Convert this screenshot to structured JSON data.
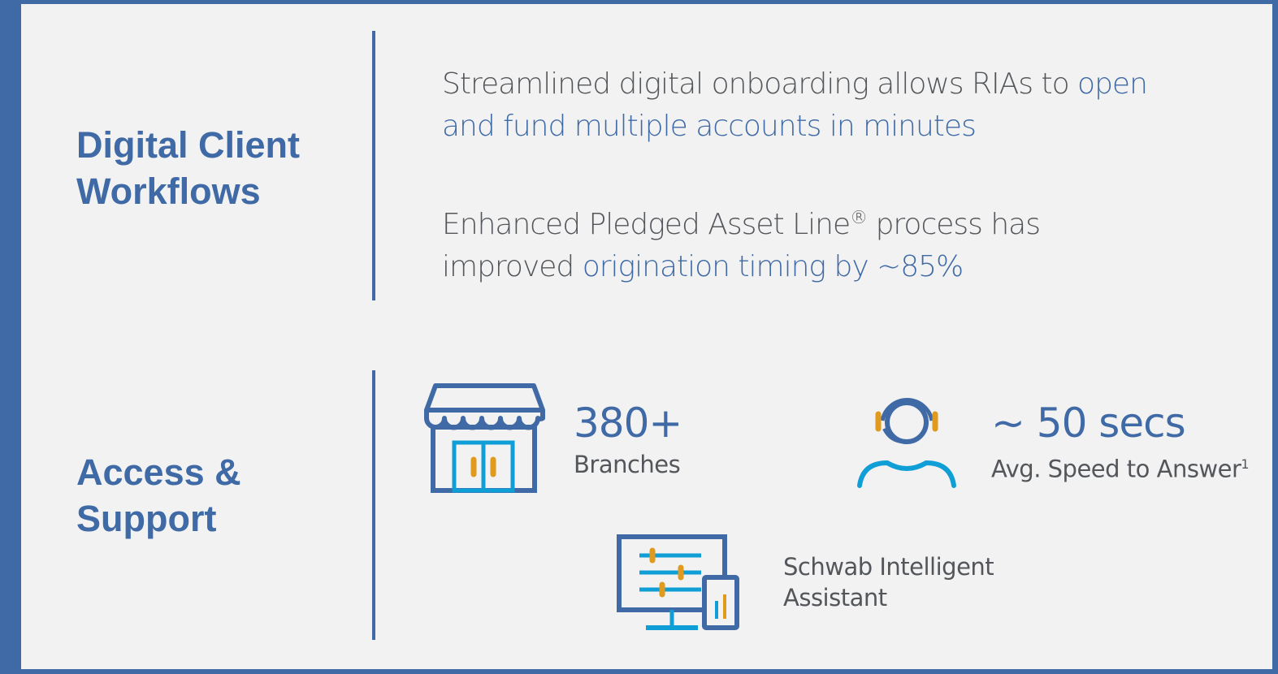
{
  "sections": [
    {
      "title_line1": "Digital Client",
      "title_line2": "Workflows"
    },
    {
      "title_line1": "Access &",
      "title_line2": "Support"
    }
  ],
  "workflows": {
    "item1": {
      "line1_plain": "Streamlined digital onboarding allows RIAs to ",
      "line1_highlight": "open",
      "line2_highlight": "and fund multiple accounts in minutes"
    },
    "item2": {
      "line1_plain": "Enhanced Pledged Asset Line",
      "line1_reg": "®",
      "line1_tail": " process has",
      "line2_plain": "improved ",
      "line2_highlight": "origination timing by ~85%"
    }
  },
  "support": {
    "branches": {
      "value": "380+",
      "label": "Branches",
      "icon": "storefront-icon"
    },
    "speed": {
      "value": "~ 50 secs",
      "label": "Avg. Speed to Answer",
      "footnote": "1",
      "icon": "headset-agent-icon"
    },
    "assistant": {
      "label_line1": "Schwab Intelligent",
      "label_line2": "Assistant",
      "icon": "monitor-settings-icon"
    }
  },
  "colors": {
    "brand_blue": "#3f6aa6",
    "accent_cyan": "#0f9ed5",
    "accent_orange": "#e09a1e",
    "body_gray": "#53565a",
    "panel_bg": "#f2f2f2"
  }
}
